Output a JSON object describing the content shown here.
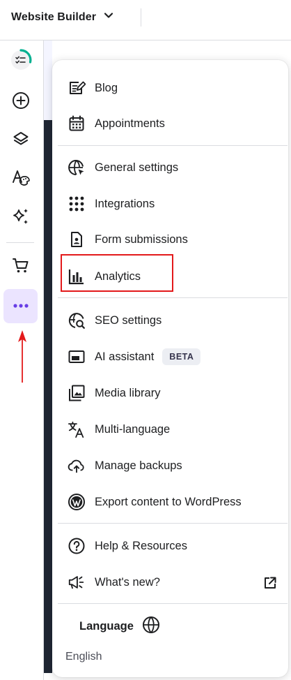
{
  "topbar": {
    "title": "Website Builder",
    "chevron_icon": "chevron-down-icon"
  },
  "sidebar": {
    "items": [
      {
        "name": "sidebar-progress",
        "icon": "checklist-progress-icon"
      },
      {
        "name": "sidebar-add",
        "icon": "plus-circle-icon"
      },
      {
        "name": "sidebar-layers",
        "icon": "layers-icon"
      },
      {
        "name": "sidebar-styles",
        "icon": "text-palette-icon"
      },
      {
        "name": "sidebar-ai",
        "icon": "sparkles-icon"
      },
      {
        "name": "sidebar-store",
        "icon": "cart-icon"
      },
      {
        "name": "sidebar-more",
        "icon": "more-dots-icon",
        "active": true
      }
    ]
  },
  "menu": {
    "items": [
      {
        "label": "Blog",
        "icon": "blog-icon"
      },
      {
        "label": "Appointments",
        "icon": "calendar-icon"
      },
      {
        "label": "General settings",
        "icon": "globe-settings-icon"
      },
      {
        "label": "Integrations",
        "icon": "grid-dots-icon"
      },
      {
        "label": "Form submissions",
        "icon": "form-file-icon"
      },
      {
        "label": "Analytics",
        "icon": "bar-chart-icon"
      },
      {
        "label": "SEO settings",
        "icon": "seo-icon"
      },
      {
        "label": "AI assistant",
        "icon": "ai-window-icon",
        "badge": "BETA"
      },
      {
        "label": "Media library",
        "icon": "media-icon"
      },
      {
        "label": "Multi-language",
        "icon": "translate-icon"
      },
      {
        "label": "Manage backups",
        "icon": "cloud-upload-icon"
      },
      {
        "label": "Export content to WordPress",
        "icon": "wordpress-icon"
      },
      {
        "label": "Help & Resources",
        "icon": "help-icon"
      },
      {
        "label": "What's new?",
        "icon": "megaphone-icon"
      }
    ],
    "language": {
      "title": "Language",
      "value": "English"
    }
  },
  "colors": {
    "accent": "#673de6",
    "active_bg": "#ebe4ff",
    "highlight": "#e3191b",
    "progress": "#00b090"
  }
}
